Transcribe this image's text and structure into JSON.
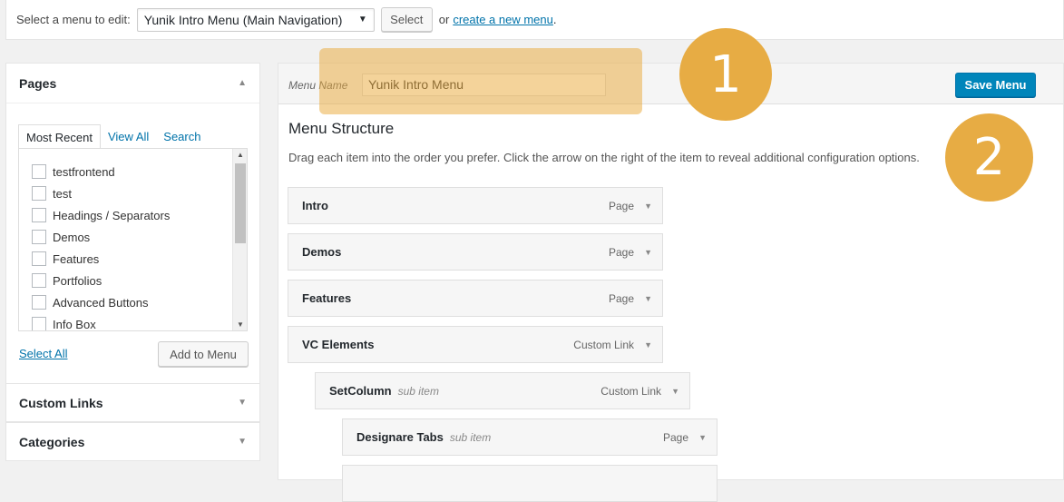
{
  "topbar": {
    "label": "Select a menu to edit:",
    "menu_selected": "Yunik Intro Menu (Main Navigation)",
    "select_button": "Select",
    "or_text": "or",
    "create_link": "create a new menu",
    "period": "."
  },
  "pages_box": {
    "title": "Pages",
    "tabs": [
      "Most Recent",
      "View All",
      "Search"
    ],
    "items": [
      "testfrontend",
      "test",
      "Headings / Separators",
      "Demos",
      "Features",
      "Portfolios",
      "Advanced Buttons",
      "Info Box"
    ],
    "select_all": "Select All",
    "add_button": "Add to Menu"
  },
  "custom_links": {
    "title": "Custom Links"
  },
  "categories": {
    "title": "Categories"
  },
  "menu_editor": {
    "name_label": "Menu Name",
    "name_value": "Yunik Intro Menu",
    "save_button": "Save Menu",
    "structure_title": "Menu Structure",
    "structure_desc": "Drag each item into the order you prefer. Click the arrow on the right of the item to reveal additional configuration options.",
    "items": [
      {
        "title": "Intro",
        "sub": "",
        "type": "Page",
        "depth": 0
      },
      {
        "title": "Demos",
        "sub": "",
        "type": "Page",
        "depth": 0
      },
      {
        "title": "Features",
        "sub": "",
        "type": "Page",
        "depth": 0
      },
      {
        "title": "VC Elements",
        "sub": "",
        "type": "Custom Link",
        "depth": 0
      },
      {
        "title": "SetColumn",
        "sub": "sub item",
        "type": "Custom Link",
        "depth": 1
      },
      {
        "title": "Designare Tabs",
        "sub": "sub item",
        "type": "Page",
        "depth": 2
      }
    ]
  },
  "overlays": {
    "badge1": "1",
    "badge2": "2"
  },
  "colors": {
    "accent": "#0085ba",
    "badge": "#e7ac44",
    "link": "#0073aa"
  }
}
